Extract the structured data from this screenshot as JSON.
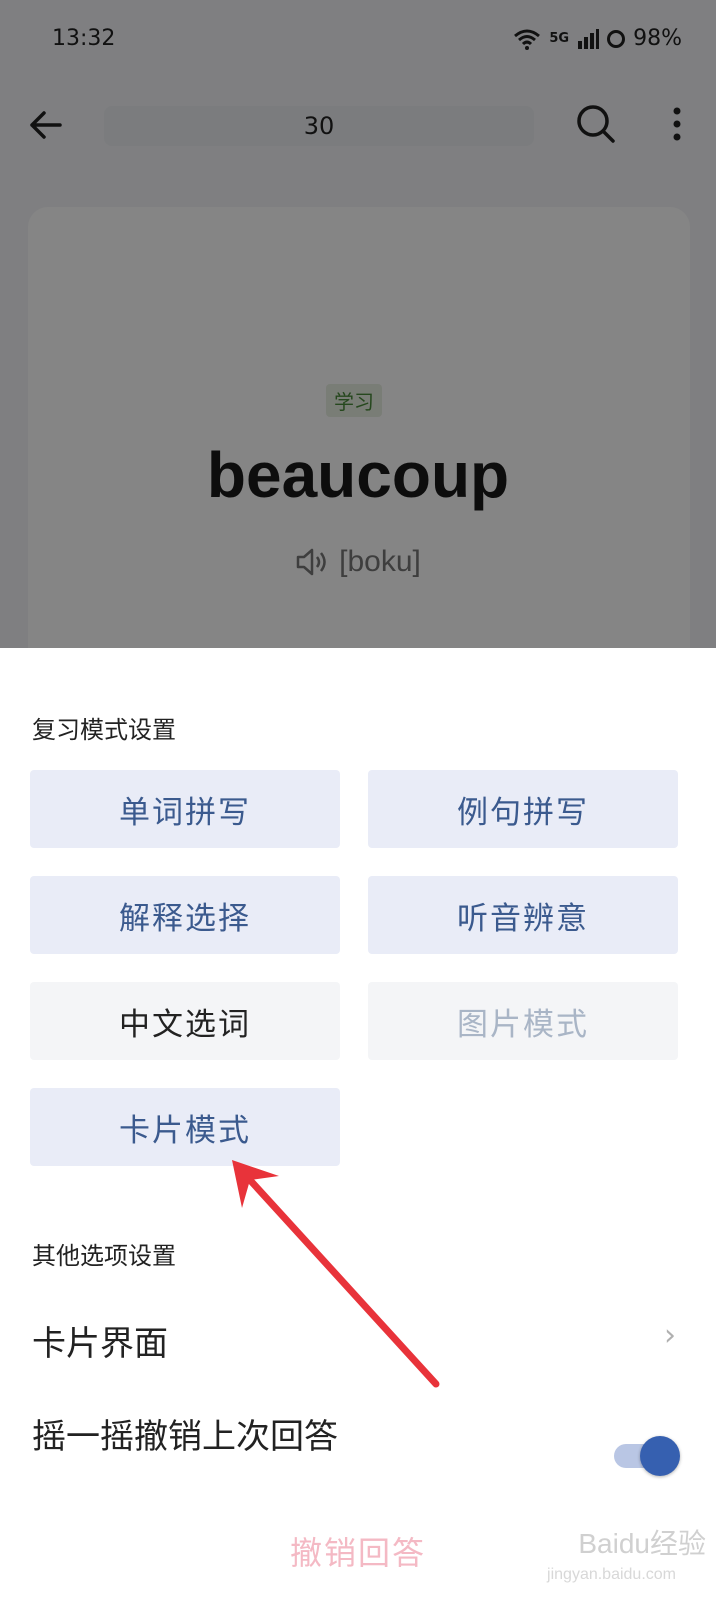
{
  "status_bar": {
    "time": "13:32",
    "network": "5G",
    "battery": "98%"
  },
  "header": {
    "title": "30"
  },
  "card": {
    "tag": "学习",
    "word": "beaucoup",
    "phonetic": "[boku]"
  },
  "sheet": {
    "review_section_title": "复习模式设置",
    "modes": [
      {
        "label": "单词拼写",
        "state": "active"
      },
      {
        "label": "例句拼写",
        "state": "active"
      },
      {
        "label": "解释选择",
        "state": "active"
      },
      {
        "label": "听音辨意",
        "state": "active"
      },
      {
        "label": "中文选词",
        "state": "inactive"
      },
      {
        "label": "图片模式",
        "state": "disabled"
      },
      {
        "label": "卡片模式",
        "state": "active"
      }
    ],
    "other_section_title": "其他选项设置",
    "card_interface_label": "卡片界面",
    "shake_undo_label": "摇一摇撤销上次回答",
    "shake_undo_enabled": true,
    "undo_answer_label": "撤销回答"
  },
  "watermark": {
    "brand": "Baidu经验",
    "url": "jingyan.baidu.com"
  },
  "colors": {
    "accent": "#3b5a8e",
    "toggle": "#3660b0",
    "annotation_arrow": "#e8333a",
    "undo": "#f4b9c4"
  }
}
